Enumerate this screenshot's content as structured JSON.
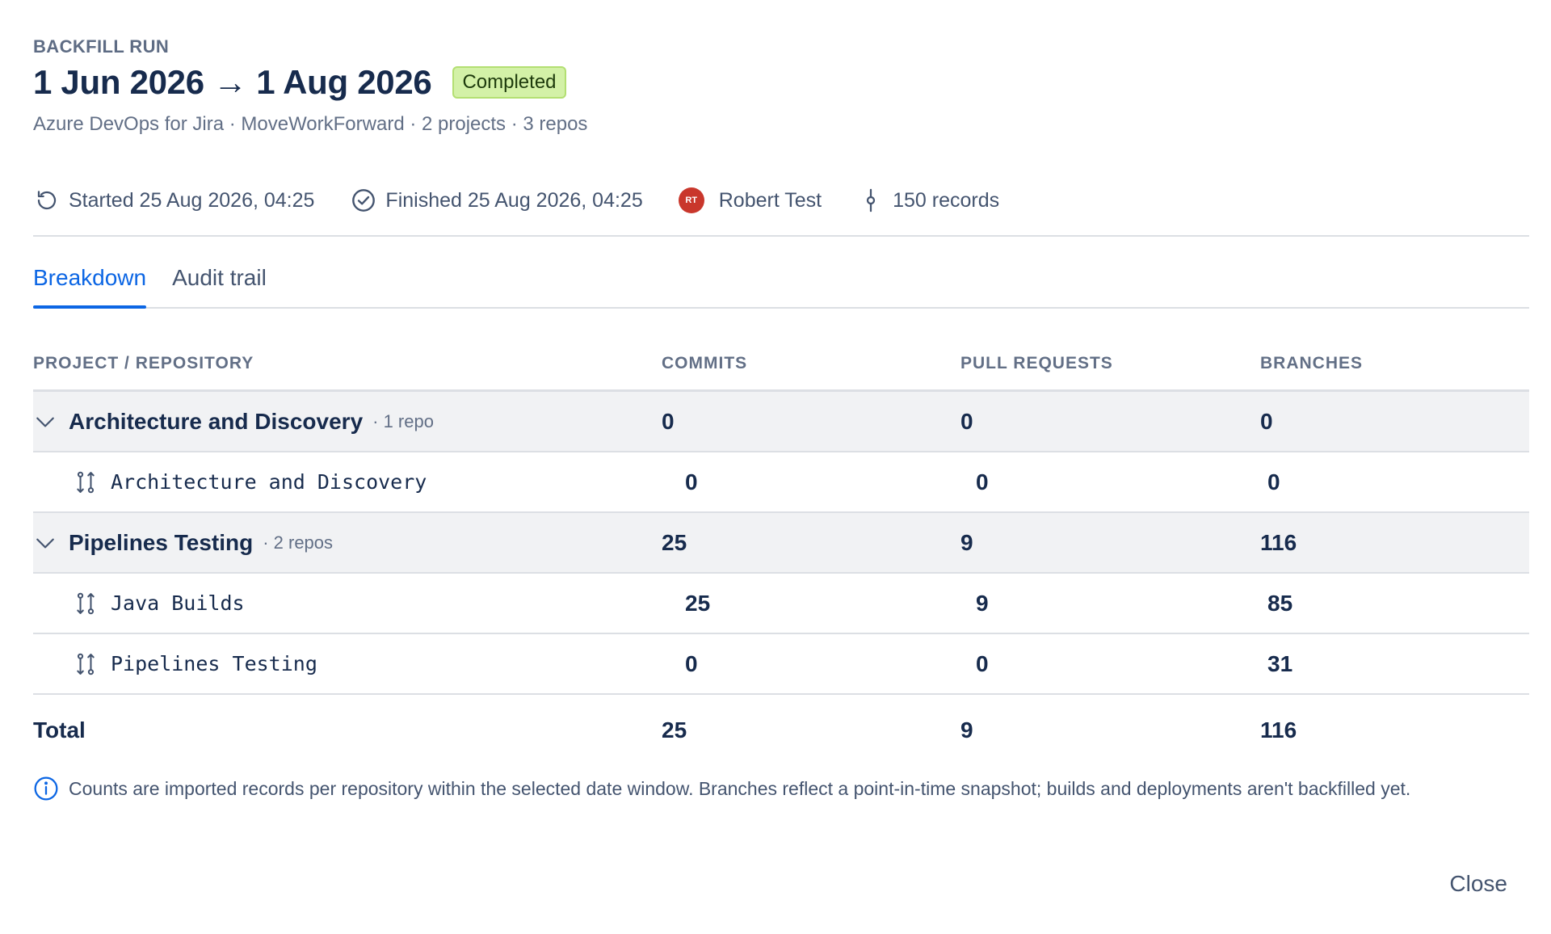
{
  "header": {
    "eyebrow": "BACKFILL RUN",
    "title": "1 Jun 2026 → 1 Aug 2026",
    "status_badge": "Completed",
    "subtitle": "Azure DevOps for Jira · MoveWorkForward · 2 projects · 3 repos"
  },
  "meta": {
    "started": "Started 25 Aug 2026, 04:25",
    "finished": "Finished 25 Aug 2026, 04:25",
    "user_initials": "RT",
    "user_name": "Robert Test",
    "records": "150 records",
    "avatar_color": "#c9372c"
  },
  "tabs": [
    {
      "label": "Breakdown",
      "active": true
    },
    {
      "label": "Audit trail",
      "active": false
    }
  ],
  "table": {
    "columns": {
      "name": "PROJECT / REPOSITORY",
      "commits": "COMMITS",
      "pull_requests": "PULL REQUESTS",
      "branches": "BRANCHES"
    },
    "groups": [
      {
        "name": "Architecture and Discovery",
        "repo_count": "· 1 repo",
        "commits": "0",
        "pull_requests": "0",
        "branches": "0",
        "repos": [
          {
            "name": "Architecture and Discovery",
            "commits": "0",
            "pull_requests": "0",
            "branches": "0"
          }
        ]
      },
      {
        "name": "Pipelines Testing",
        "repo_count": "· 2 repos",
        "commits": "25",
        "pull_requests": "9",
        "branches": "116",
        "repos": [
          {
            "name": "Java Builds",
            "commits": "25",
            "pull_requests": "9",
            "branches": "85"
          },
          {
            "name": "Pipelines Testing",
            "commits": "0",
            "pull_requests": "0",
            "branches": "31"
          }
        ]
      }
    ],
    "total": {
      "label": "Total",
      "commits": "25",
      "pull_requests": "9",
      "branches": "116"
    }
  },
  "note": "Counts are imported records per repository within the selected date window. Branches reflect a point-in-time snapshot; builds and deployments aren't backfilled yet.",
  "footer": {
    "close_label": "Close"
  },
  "colors": {
    "accent": "#0c66e4",
    "badge_bg": "#d3f1a7",
    "group_row_bg": "#f1f2f4"
  }
}
